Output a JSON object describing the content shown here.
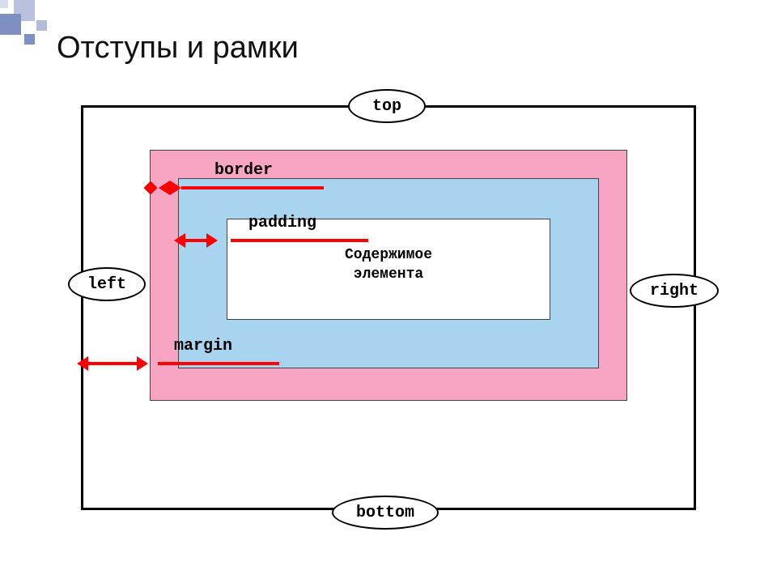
{
  "title": "Отступы и рамки",
  "sides": {
    "top": "top",
    "bottom": "bottom",
    "left": "left",
    "right": "right"
  },
  "labels": {
    "border": "border",
    "padding": "padding",
    "margin": "margin"
  },
  "content": {
    "line1": "Содержимое",
    "line2": "элемента"
  },
  "colors": {
    "margin_bg": "#ffffff",
    "border_bg": "#f8a5c4",
    "padding_bg": "#a8d4ef",
    "content_bg": "#ffffff",
    "arrow": "#ff0000"
  }
}
